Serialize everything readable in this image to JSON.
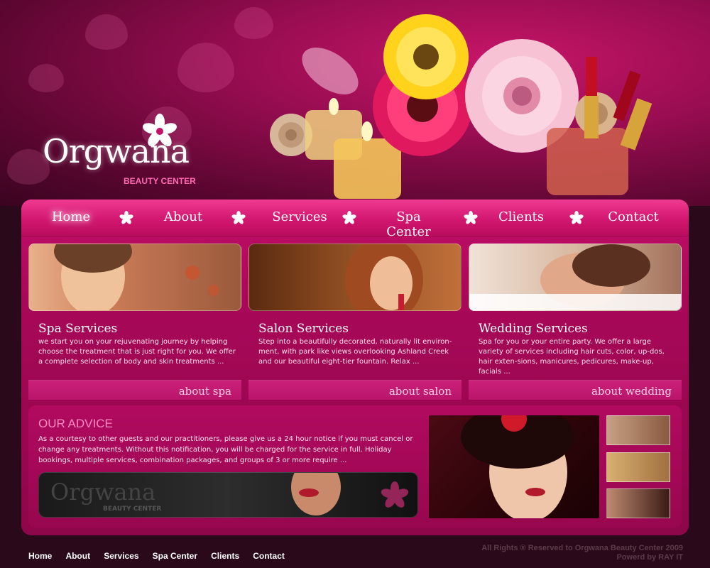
{
  "logo": {
    "name": "Orgwana",
    "subtitle": "BEAUTY CENTER"
  },
  "nav": {
    "items": [
      {
        "label": "Home",
        "active": true
      },
      {
        "label": "About"
      },
      {
        "label": "Services"
      },
      {
        "label": "Spa Center"
      },
      {
        "label": "Clients"
      },
      {
        "label": "Contact"
      }
    ]
  },
  "cards": [
    {
      "title": "Spa Services",
      "text": "we start you on your rejuvenating journey by helping choose the treatment that is just right for you. We offer a complete selection of body and skin treatments ...",
      "link": "about spa"
    },
    {
      "title": "Salon Services",
      "text": "Step into a beautifully decorated, naturally lit environ-ment, with park like views overlooking Ashland Creek and our beautiful eight-tier fountain. Relax ...",
      "link": "about salon"
    },
    {
      "title": "Wedding Services",
      "text": "Spa for you or your entire party. We offer a large variety of services including hair cuts, color, up-dos, hair exten-sions, manicures, pedicures, make-up, facials ...",
      "link": "about wedding"
    }
  ],
  "advice": {
    "title": "OUR ADVICE",
    "text": "As a courtesy to other guests and our practitioners, please give us a 24 hour notice if you must cancel or change any treatments. Without this notification, you will be charged for the service in full. Holiday bookings, multiple services, combination packages, and groups of 3 or more require ...",
    "banner_name": "Orgwana",
    "banner_sub": "BEAUTY CENTER"
  },
  "footer": {
    "links": [
      "Home",
      "About",
      "Services",
      "Spa Center",
      "Clients",
      "Contact"
    ],
    "copyright": "All Rights ® Reserved to Orgwana Beauty Center 2009",
    "powered": "Powerd by RAY IT"
  },
  "colors": {
    "primary": "#c40f6a",
    "nav": "#d1176f",
    "background": "#2a0a1a",
    "accent": "#ff8bc4"
  }
}
